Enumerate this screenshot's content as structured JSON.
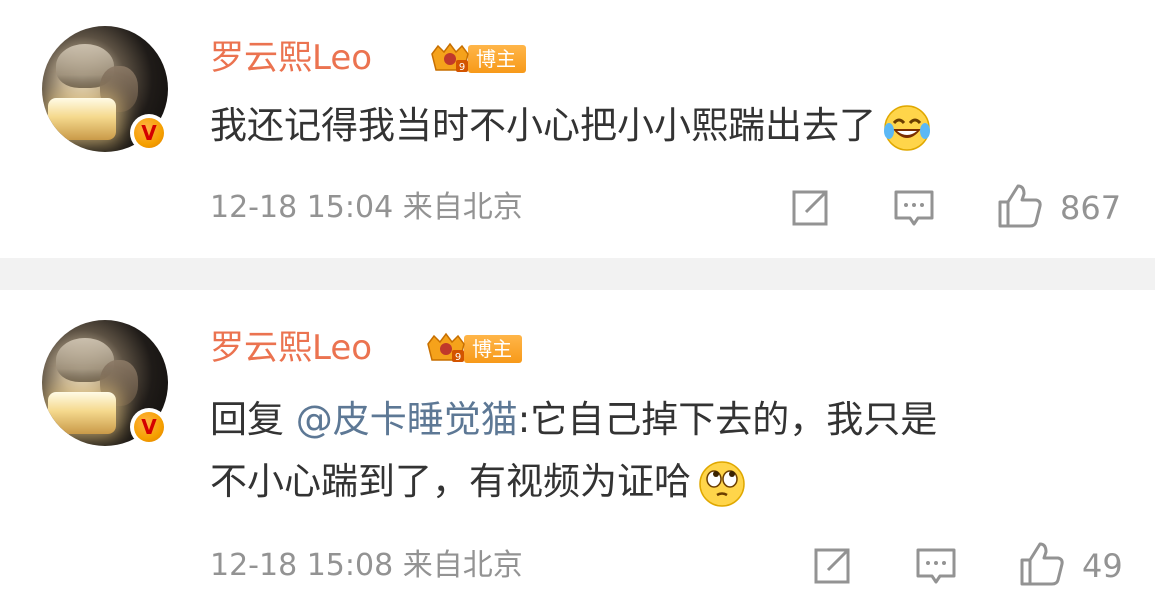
{
  "comments": [
    {
      "username": "罗云熙Leo",
      "badge_label": "博主",
      "text_before": "我还记得我当时不小心把小小熙踹出去了",
      "mention": "",
      "emoji": "laugh-cry-emoji",
      "timestamp": "12-18 15:04 来自北京",
      "likes": "867"
    },
    {
      "username": "罗云熙Leo",
      "badge_label": "博主",
      "reply_prefix": "回复",
      "mention": "@皮卡睡觉猫",
      "text_line1": ":它自己掉下去的，我只是",
      "text_line2": "不小心踹到了，有视频为证哈",
      "emoji": "eye-roll-emoji",
      "timestamp": "12-18 15:08 来自北京",
      "likes": "49"
    }
  ],
  "icons": {
    "share": "share-icon",
    "comment": "comment-icon",
    "like": "thumbs-up-icon",
    "verified": "verified-v-icon"
  },
  "colors": {
    "username": "#eb7350",
    "mention": "#5d7895",
    "meta": "#939393",
    "badge": "#f79a19"
  }
}
